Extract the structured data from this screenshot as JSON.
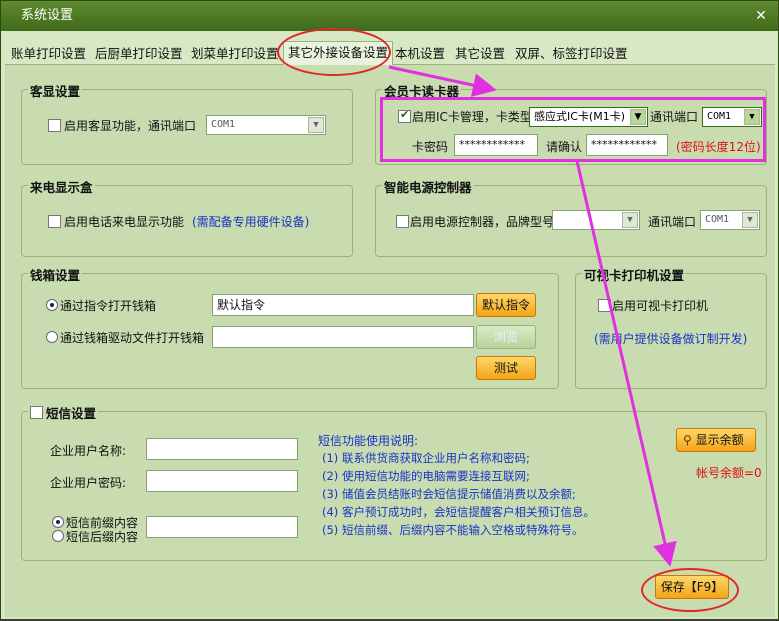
{
  "window": {
    "title": "系统设置",
    "close_glyph": "✕"
  },
  "tabs": [
    {
      "label": "账单打印设置"
    },
    {
      "label": "后厨单打印设置"
    },
    {
      "label": "划菜单打印设置"
    },
    {
      "label": "其它外接设备设置",
      "active": true
    },
    {
      "label": "本机设置"
    },
    {
      "label": "其它设置"
    },
    {
      "label": "双屏、标签打印设置"
    }
  ],
  "customer_display": {
    "title": "客显设置",
    "checkbox_label": "启用客显功能，通讯端口",
    "checked": false,
    "port": "COM1"
  },
  "card_reader": {
    "title": "会员卡读卡器",
    "checkbox_label": "启用IC卡管理，卡类型",
    "checked": true,
    "card_type": "感应式IC卡(M1卡)",
    "port_label": "通讯端口",
    "port": "COM1",
    "password_label": "卡密码",
    "password": "************",
    "confirm_label": "请确认",
    "confirm": "************",
    "note": "(密码长度12位)"
  },
  "caller_id": {
    "title": "来电显示盒",
    "checkbox_label": "启用电话来电显示功能",
    "checked": false,
    "note": "(需配备专用硬件设备)"
  },
  "power_controller": {
    "title": "智能电源控制器",
    "checkbox_label": "启用电源控制器，品牌型号",
    "checked": false,
    "model": "",
    "port_label": "通讯端口",
    "port": "COM1"
  },
  "cash_drawer": {
    "title": "钱箱设置",
    "option1": "通过指令打开钱箱",
    "option1_selected": true,
    "command": "默认指令",
    "default_cmd_btn": "默认指令",
    "option2": "通过钱箱驱动文件打开钱箱",
    "driver_file": "",
    "browse_btn": "浏览",
    "test_btn": "测试"
  },
  "visual_card_printer": {
    "title": "可视卡打印机设置",
    "checkbox_label": "启用可视卡打印机",
    "checked": false,
    "note": "(需用户提供设备做订制开发)"
  },
  "sms": {
    "title": "短信设置",
    "checked": false,
    "user_label": "企业用户名称:",
    "user_value": "",
    "pwd_label": "企业用户密码:",
    "pwd_value": "",
    "prefix_label": "短信前缀内容",
    "suffix_label": "短信后缀内容",
    "prefix_selected": true,
    "content_value": "",
    "help_title": "短信功能使用说明:",
    "help_lines": [
      "(1) 联系供货商获取企业用户名称和密码;",
      "(2) 使用短信功能的电脑需要连接互联网;",
      "(3) 储值会员结账时会短信提示储值消费以及余额;",
      "(4) 客户预订成功时，会短信提醒客户相关预订信息。",
      "(5) 短信前缀、后缀内容不能输入空格或特殊符号。"
    ],
    "balance_btn": "显示余额",
    "balance_label": "帐号余额=0"
  },
  "save_btn": "保存【F9】",
  "colors": {
    "accent_magenta": "#e030e0",
    "oval_red": "#e02828",
    "note_red": "#e01010",
    "note_blue": "#1a32c8",
    "button_orange": "#f2a418"
  }
}
